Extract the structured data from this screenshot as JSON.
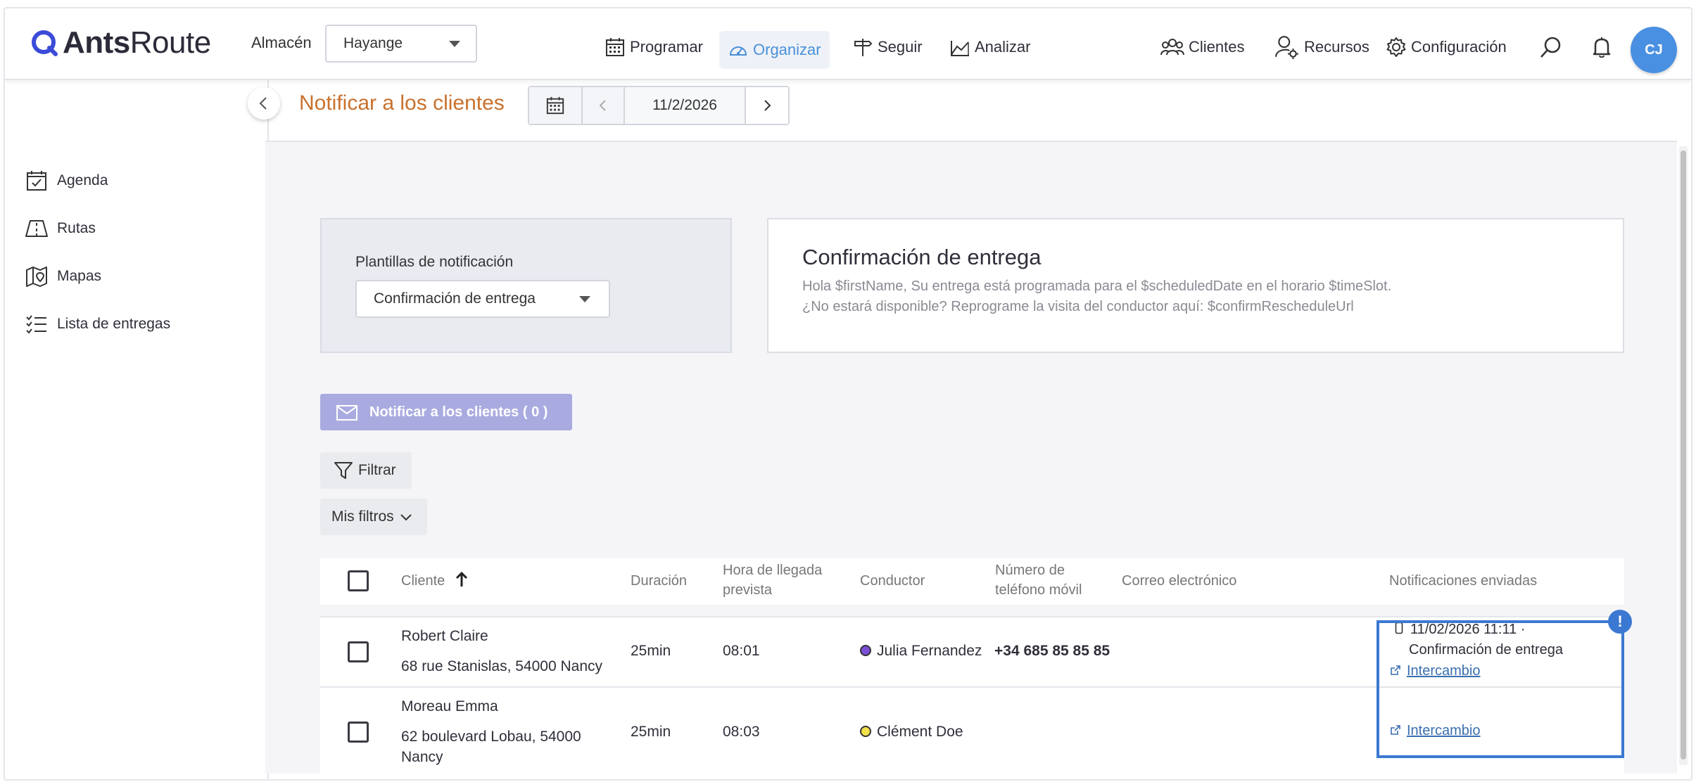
{
  "app": {
    "logo_text_bold": "Ants",
    "logo_text_light": "Route",
    "brand_color": "#2b2b39",
    "accent_color": "#4a8fd8"
  },
  "topbar": {
    "almacen_label": "Almacén",
    "almacen_value": "Hayange",
    "nav": [
      {
        "label": "Programar",
        "icon": "calendar-grid-icon",
        "active": false
      },
      {
        "label": "Organizar",
        "icon": "gauge-icon",
        "active": true
      },
      {
        "label": "Seguir",
        "icon": "signpost-icon",
        "active": false
      },
      {
        "label": "Analizar",
        "icon": "chart-icon",
        "active": false
      }
    ],
    "right_nav": [
      {
        "label": "Clientes",
        "icon": "users-icon"
      },
      {
        "label": "Recursos",
        "icon": "user-gear-icon"
      },
      {
        "label": "Configuración",
        "icon": "gear-icon"
      }
    ],
    "avatar_initials": "CJ"
  },
  "sidebar": {
    "items": [
      {
        "label": "Agenda",
        "icon": "calendar-check-icon"
      },
      {
        "label": "Rutas",
        "icon": "map-route-icon"
      },
      {
        "label": "Mapas",
        "icon": "map-pin-icon"
      },
      {
        "label": "Lista de entregas",
        "icon": "checklist-icon"
      }
    ]
  },
  "page": {
    "title": "Notificar a los clientes",
    "date": "11/2/2026"
  },
  "templates": {
    "label": "Plantillas de notificación",
    "selected": "Confirmación de entrega",
    "preview_title": "Confirmación de entrega",
    "preview_line1": "Hola $firstName, Su entrega está programada para el $scheduledDate en el horario $timeSlot.",
    "preview_line2": "¿No estará disponible? Reprograme la visita del conductor aquí: $confirmRescheduleUrl"
  },
  "actions": {
    "notify_label": "Notificar a los clientes ( 0 )",
    "filter_label": "Filtrar",
    "my_filters_label": "Mis filtros"
  },
  "table": {
    "headers": {
      "cliente": "Cliente",
      "duracion": "Duración",
      "hora_1": "Hora de llegada",
      "hora_2": "prevista",
      "conductor": "Conductor",
      "telefono_1": "Número de",
      "telefono_2": "teléfono móvil",
      "correo": "Correo electrónico",
      "notificaciones": "Notificaciones enviadas"
    },
    "rows": [
      {
        "name": "Robert Claire",
        "address": "68 rue Stanislas, 54000 Nancy",
        "address_2": "",
        "duration": "25min",
        "eta": "08:01",
        "driver": "Julia Fernandez",
        "driver_color": "#7b4fd6",
        "phone": "+34 685 85 85 85",
        "email": "",
        "notif_line1": "11/02/2026 11:11 ·",
        "notif_line2": "Confirmación de entrega",
        "link": "Intercambio"
      },
      {
        "name": "Moreau Emma",
        "address": "62 boulevard Lobau, 54000",
        "address_2": "Nancy",
        "duration": "25min",
        "eta": "08:03",
        "driver": "Clément Doe",
        "driver_color": "#f3e04a",
        "phone": "",
        "email": "",
        "notif_line1": "",
        "notif_line2": "",
        "link": "Intercambio"
      }
    ],
    "warning_badge": "!"
  }
}
